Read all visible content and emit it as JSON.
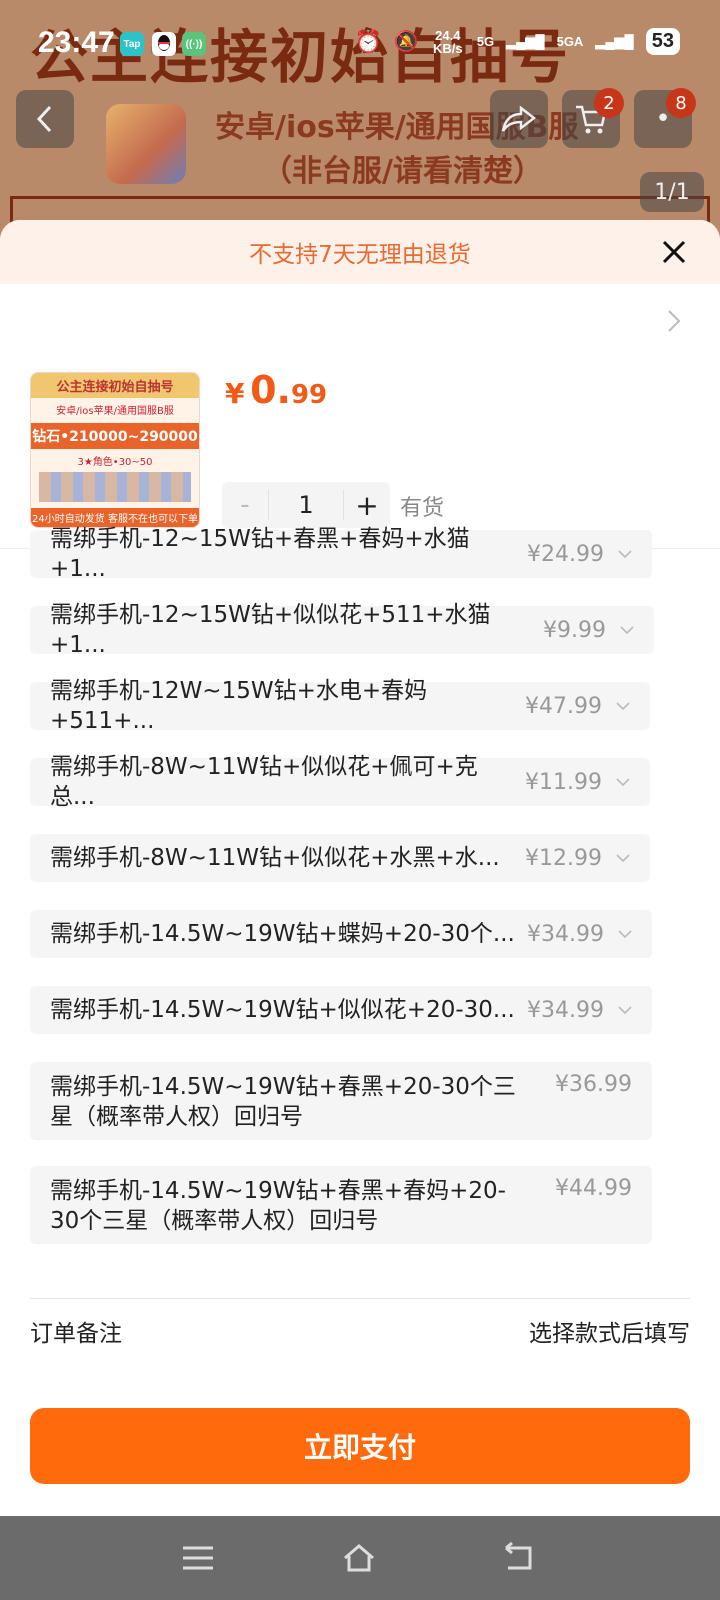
{
  "status": {
    "time": "23:47",
    "app_icons": [
      "Tap",
      "qq-icon",
      "signal-icon"
    ],
    "net_speed": "24.4 KB/s",
    "net1": "5G",
    "net2": "5GA",
    "battery": "53"
  },
  "background_page": {
    "banner_title": "公主连接初始自抽号",
    "banner_line1": "安卓/ios苹果/通用国服B服",
    "banner_line2": "（非台服/请看清楚）",
    "cart_badge": "2",
    "more_badge": "8",
    "image_counter": "1/1"
  },
  "sheet": {
    "notice": "不支持7天无理由退货",
    "thumb": {
      "title": "公主连接初始自抽号",
      "subtitle": "安卓/ios苹果/通用国服B服",
      "diamonds": "钻石•210000~290000",
      "stars": "3★角色•30~50",
      "footer": "24小时自动发货 客服不在也可以下单"
    },
    "price": {
      "symbol": "¥",
      "integer": "0.",
      "decimal": "99"
    },
    "quantity": "1",
    "minus": "-",
    "plus": "+",
    "stock": "有货",
    "options": [
      {
        "label": "需绑手机-12~15W钻+春黑+春妈+水猫+1...",
        "price": "¥24.99"
      },
      {
        "label": "需绑手机-12~15W钻+似似花+511+水猫+1...",
        "price": "¥9.99"
      },
      {
        "label": "需绑手机-12W~15W钻+水电+春妈+511+...",
        "price": "¥47.99"
      },
      {
        "label": "需绑手机-8W~11W钻+似似花+佩可+克总...",
        "price": "¥11.99"
      },
      {
        "label": "需绑手机-8W~11W钻+似似花+水黑+水...",
        "price": "¥12.99"
      },
      {
        "label": "需绑手机-14.5W~19W钻+蝶妈+20-30个...",
        "price": "¥34.99"
      },
      {
        "label": "需绑手机-14.5W~19W钻+似似花+20-30...",
        "price": "¥34.99"
      },
      {
        "label": "需绑手机-14.5W~19W钻+春黑+20-30个三星（概率带人权）回归号",
        "price": "¥36.99"
      },
      {
        "label": "需绑手机-14.5W~19W钻+春黑+春妈+20-30个三星（概率带人权）回归号",
        "price": "¥44.99"
      }
    ],
    "memo_label": "订单备注",
    "memo_value": "选择款式后填写",
    "pay_label": "立即支付"
  },
  "colors": {
    "accent": "#ff6a0d",
    "price": "#f25a16",
    "notice": "#e96a30"
  }
}
